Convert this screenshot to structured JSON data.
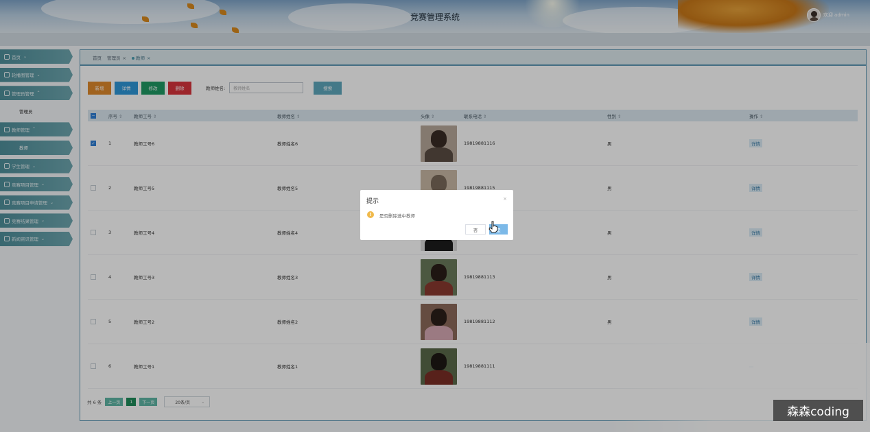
{
  "header": {
    "title": "竞赛管理系统",
    "user": "欢迎 admin"
  },
  "sidebar": {
    "items": [
      {
        "label": "首页",
        "icon": "home-icon"
      },
      {
        "label": "轮播图管理",
        "icon": "carousel-icon"
      },
      {
        "label": "管理员管理",
        "icon": "admin-icon"
      },
      {
        "label": "管理员",
        "sub": true
      },
      {
        "label": "教师管理",
        "icon": "user-icon"
      },
      {
        "label": "教师",
        "sub": true,
        "active": true
      },
      {
        "label": "学生管理",
        "icon": "user-icon"
      },
      {
        "label": "竞赛项目管理",
        "icon": "project-icon"
      },
      {
        "label": "竞赛项目申请管理",
        "icon": "apply-icon"
      },
      {
        "label": "竞赛结果管理",
        "icon": "result-icon"
      },
      {
        "label": "新闻资讯管理",
        "icon": "news-icon"
      }
    ]
  },
  "tabs": [
    {
      "label": "首页"
    },
    {
      "label": "管理员",
      "close": "×"
    },
    {
      "label": "教师",
      "close": "×",
      "active": true
    }
  ],
  "toolbar": {
    "add": "新增",
    "detail": "详情",
    "edit": "修改",
    "delete": "删除",
    "search_label": "教师姓名:",
    "search_placeholder": "教师姓名",
    "search_btn": "搜索"
  },
  "table": {
    "headers": [
      "序号",
      "教师工号",
      "教师姓名",
      "头像",
      "联系电话",
      "性别",
      "操作"
    ],
    "rows": [
      {
        "no": "1",
        "id": "教师工号6",
        "name": "教师姓名6",
        "phone": "19819881116",
        "sex": "男",
        "op": "详情",
        "checked": true
      },
      {
        "no": "2",
        "id": "教师工号5",
        "name": "教师姓名5",
        "phone": "19819881115",
        "sex": "男",
        "op": "详情"
      },
      {
        "no": "3",
        "id": "教师工号4",
        "name": "教师姓名4",
        "phone": "19819881114",
        "sex": "男",
        "op": "详情"
      },
      {
        "no": "4",
        "id": "教师工号3",
        "name": "教师姓名3",
        "phone": "19819881113",
        "sex": "男",
        "op": "详情"
      },
      {
        "no": "5",
        "id": "教师工号2",
        "name": "教师姓名2",
        "phone": "19819881112",
        "sex": "男",
        "op": "详情"
      },
      {
        "no": "6",
        "id": "教师工号1",
        "name": "教师姓名1",
        "phone": "19819881111",
        "sex": "",
        "op": ""
      }
    ]
  },
  "pager": {
    "total": "共 6 条",
    "prev": "上一页",
    "page": "1",
    "next": "下一页",
    "size": "20条/页"
  },
  "dialog": {
    "title": "提示",
    "close": "×",
    "message": "是否删除选中教师",
    "cancel": "否",
    "ok": "是"
  },
  "watermark": "森森coding",
  "colors": {
    "primary": "#5d97b4",
    "add": "#e0892b",
    "detail": "#2e98d8",
    "edit": "#1f9a65",
    "delete": "#d9343c"
  }
}
